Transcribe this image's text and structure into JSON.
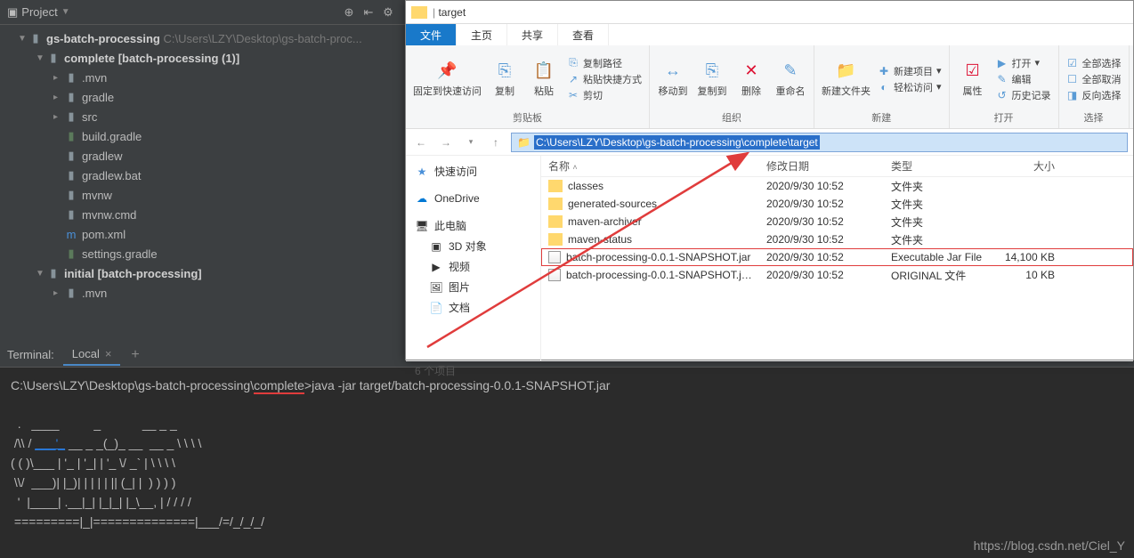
{
  "ide": {
    "panel_title": "Project",
    "root": {
      "name": "gs-batch-processing",
      "path": "C:\\Users\\LZY\\Desktop\\gs-batch-proc..."
    },
    "complete": {
      "name": "complete",
      "suffix": "[batch-processing (1)]"
    },
    "complete_children": [
      {
        "name": ".mvn",
        "type": "folder"
      },
      {
        "name": "gradle",
        "type": "folder"
      },
      {
        "name": "src",
        "type": "folder"
      },
      {
        "name": "build.gradle",
        "type": "file"
      },
      {
        "name": "gradlew",
        "type": "file"
      },
      {
        "name": "gradlew.bat",
        "type": "file"
      },
      {
        "name": "mvnw",
        "type": "file"
      },
      {
        "name": "mvnw.cmd",
        "type": "file"
      },
      {
        "name": "pom.xml",
        "type": "maven"
      },
      {
        "name": "settings.gradle",
        "type": "file"
      }
    ],
    "initial": {
      "name": "initial",
      "suffix": "[batch-processing]"
    },
    "initial_children": [
      {
        "name": ".mvn",
        "type": "folder"
      }
    ]
  },
  "terminal": {
    "label": "Terminal:",
    "tab": "Local",
    "prompt_path": "C:\\Users\\LZY\\Desktop\\gs-batch-processing\\",
    "prompt_highlight": "complete",
    "prompt_suffix": ">",
    "command": "java -jar target/batch-processing-0.0.1-SNAPSHOT.jar",
    "ascii1": "  .   ____          _            __ _ _",
    "ascii2_a": " /\\\\ / ",
    "ascii2_link": "___'_",
    "ascii2_b": " __ _ _(_)_ __  __ _ \\ \\ \\ \\",
    "ascii3": "( ( )\\___ | '_ | '_| | '_ \\/ _` | \\ \\ \\ \\",
    "ascii4": " \\\\/  ___)| |_)| | | | | || (_| |  ) ) ) )",
    "ascii5": "  '  |____| .__|_| |_|_| |_\\__, | / / / /",
    "ascii6": " =========|_|==============|___/=/_/_/_/"
  },
  "explorer": {
    "title_folder": "target",
    "tabs": {
      "file": "文件",
      "home": "主页",
      "share": "共享",
      "view": "查看"
    },
    "ribbon": {
      "pin": "固定到快速访问",
      "copy": "复制",
      "paste": "粘贴",
      "copypath": "复制路径",
      "pasteshortcut": "粘贴快捷方式",
      "cut": "剪切",
      "clipboard_label": "剪贴板",
      "moveto": "移动到",
      "copyto": "复制到",
      "delete": "删除",
      "rename": "重命名",
      "organize_label": "组织",
      "newfolder": "新建文件夹",
      "newitem": "新建项目",
      "easyaccess": "轻松访问",
      "new_label": "新建",
      "properties": "属性",
      "open": "打开",
      "edit": "编辑",
      "history": "历史记录",
      "open_label": "打开",
      "selectall": "全部选择",
      "selectnone": "全部取消",
      "invertsel": "反向选择",
      "select_label": "选择"
    },
    "path": "C:\\Users\\LZY\\Desktop\\gs-batch-processing\\complete\\target",
    "columns": {
      "name": "名称",
      "date": "修改日期",
      "type": "类型",
      "size": "大小"
    },
    "nav": {
      "quickaccess": "快速访问",
      "onedrive": "OneDrive",
      "thispc": "此电脑",
      "objects3d": "3D 对象",
      "videos": "视频",
      "pictures": "图片",
      "documents": "文档"
    },
    "files": [
      {
        "name": "classes",
        "date": "2020/9/30 10:52",
        "type": "文件夹",
        "size": "",
        "icon": "folder"
      },
      {
        "name": "generated-sources",
        "date": "2020/9/30 10:52",
        "type": "文件夹",
        "size": "",
        "icon": "folder"
      },
      {
        "name": "maven-archiver",
        "date": "2020/9/30 10:52",
        "type": "文件夹",
        "size": "",
        "icon": "folder"
      },
      {
        "name": "maven-status",
        "date": "2020/9/30 10:52",
        "type": "文件夹",
        "size": "",
        "icon": "folder"
      },
      {
        "name": "batch-processing-0.0.1-SNAPSHOT.jar",
        "date": "2020/9/30 10:52",
        "type": "Executable Jar File",
        "size": "14,100 KB",
        "icon": "jar",
        "highlight": true
      },
      {
        "name": "batch-processing-0.0.1-SNAPSHOT.ja...",
        "date": "2020/9/30 10:52",
        "type": "ORIGINAL 文件",
        "size": "10 KB",
        "icon": "jar"
      }
    ],
    "status": "6 个项目"
  },
  "watermark": "https://blog.csdn.net/Ciel_Y"
}
